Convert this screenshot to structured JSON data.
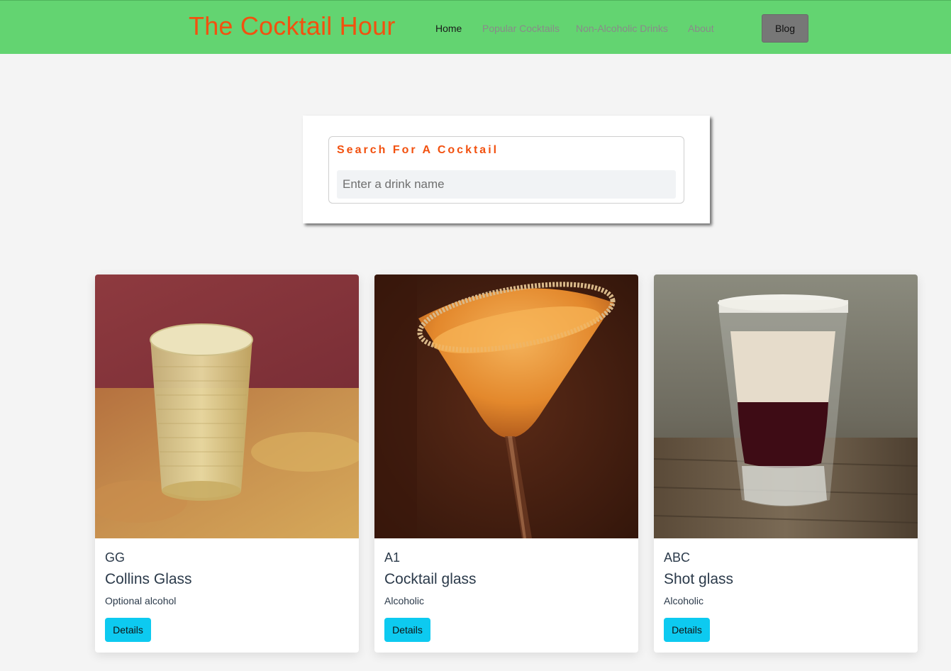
{
  "navbar": {
    "brand": "The Cocktail Hour",
    "links": [
      {
        "label": "Home",
        "active": true
      },
      {
        "label": "Popular Cocktails",
        "active": false
      },
      {
        "label": "Non-Alcoholic Drinks",
        "active": false
      },
      {
        "label": "About",
        "active": false
      }
    ],
    "blog_label": "Blog"
  },
  "search": {
    "legend": "Search For A Cocktail",
    "placeholder": "Enter a drink name",
    "value": ""
  },
  "cards": [
    {
      "code": "GG",
      "title": "Collins Glass",
      "subtitle": "Optional alcohol",
      "button": "Details",
      "image": "rocks-glass-photo"
    },
    {
      "code": "A1",
      "title": "Cocktail glass",
      "subtitle": "Alcoholic",
      "button": "Details",
      "image": "martini-glass-photo"
    },
    {
      "code": "ABC",
      "title": "Shot glass",
      "subtitle": "Alcoholic",
      "button": "Details",
      "image": "shot-glass-photo"
    }
  ],
  "colors": {
    "navbar_bg": "#63d471",
    "brand_accent": "#f2510f",
    "details_button": "#0dcaf0",
    "blog_button": "#777777",
    "page_bg": "#f4f4f4"
  }
}
